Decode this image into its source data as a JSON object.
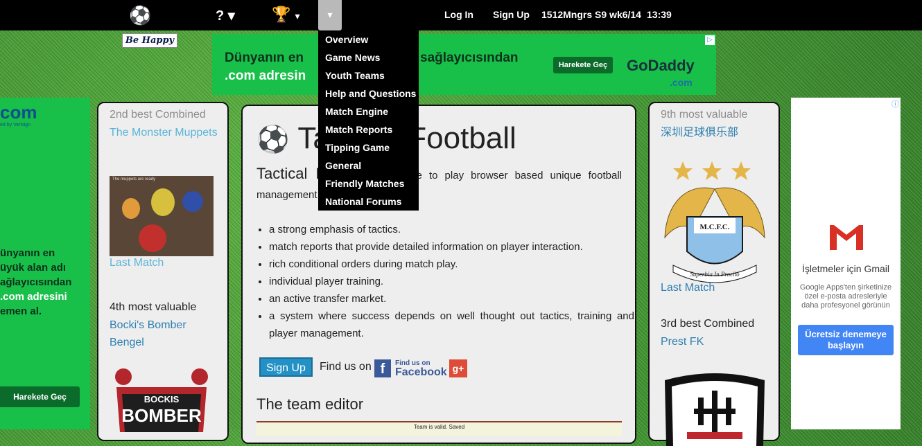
{
  "topbar": {
    "help_label": "? ▾",
    "trophy_label": "▾",
    "menu_label": "▾",
    "login": "Log In",
    "signup": "Sign Up",
    "status": "1512Mngrs S9 wk6/14",
    "time": "13:39"
  },
  "menu": {
    "items": [
      "Overview",
      "Game News",
      "Youth Teams",
      "Help and Questions",
      "Match Engine",
      "Match Reports",
      "Tipping Game",
      "General",
      "Friendly Matches",
      "National Forums"
    ]
  },
  "banner": {
    "be_happy": "Be Happy"
  },
  "top_ad": {
    "line1": "Dünyanın en",
    "line1b": "sağlayıcısından",
    "line2": ".com adresin",
    "cta": "Harekete Geç",
    "brand": "GoDaddy",
    "brand_sub": ".com",
    "ad_info": "▷"
  },
  "left_ad": {
    "logo": "com",
    "logo_sub": "ed by Verisign",
    "text_lines": [
      "ünyanın en",
      "üyük alan adı",
      "ağlayıcısından",
      ".com adresini",
      "emen al."
    ],
    "cta": "Harekete Geç"
  },
  "left_panel": {
    "combined_label": "2nd best Combined",
    "combined_club": "The Monster Muppets",
    "image_caption": "The muppets are ready",
    "combined_link": "Last Match",
    "valuable_label": "4th most valuable",
    "valuable_club": "Bocki's Bomber Bengel",
    "badge_text1": "BOCKIS",
    "badge_text2": "BOMBER"
  },
  "main": {
    "title": "Tactical Football",
    "intro_big": "Tactical Football",
    "intro_text": "is a free to play browser based unique football management game featuring:",
    "features": [
      "a strong emphasis of tactics.",
      "match reports that provide detailed information on player interaction.",
      "rich conditional orders during match play.",
      "individual player training.",
      "an active transfer market.",
      "a system where success depends on well thought out tactics, training and player management."
    ],
    "signup": "Sign Up",
    "find_us": "Find us on",
    "fb_small": "Find us on",
    "fb_big": "Facebook",
    "gplus": "g+",
    "editor_title": "The team editor",
    "editor_status": "Team is valid. Saved"
  },
  "right_panel": {
    "valuable_label": "9th most valuable",
    "valuable_club": "深圳足球俱乐部",
    "crest_text": "M.C.F.C.",
    "crest_motto": "Superbia In Proelio",
    "valuable_link": "Last Match",
    "combined_label": "3rd best Combined",
    "combined_club": "Prest FK"
  },
  "right_ad": {
    "title": "İşletmeler için Gmail",
    "desc": "Google Apps'ten şirketinize özel e-posta adresleriyle daha profesyonel görünün",
    "cta": "Ücretsiz denemeye başlayın",
    "ad_info": "ⓘ"
  },
  "colors": {
    "link": "#5bb5d8",
    "link_dark": "#2d7fb0",
    "ad_green": "#18c04a",
    "button_blue": "#2391c6"
  }
}
